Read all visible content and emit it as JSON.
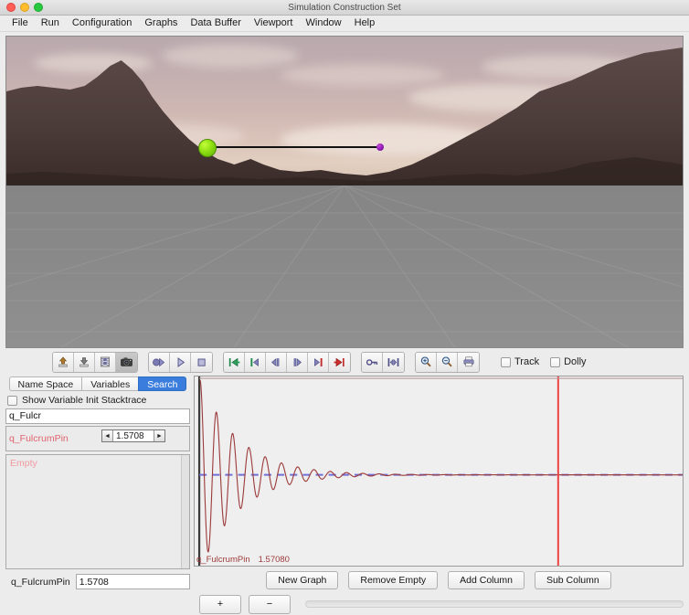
{
  "window": {
    "title": "Simulation Construction Set",
    "traffic_lights": [
      "close-button",
      "minimize-button",
      "maximize-button"
    ]
  },
  "menubar": {
    "items": [
      {
        "label": "File"
      },
      {
        "label": "Run"
      },
      {
        "label": "Configuration"
      },
      {
        "label": "Graphs"
      },
      {
        "label": "Data Buffer"
      },
      {
        "label": "Viewport"
      },
      {
        "label": "Window"
      },
      {
        "label": "Help"
      }
    ]
  },
  "viewport": {
    "scene": "pendulum-on-mountain-skybox",
    "pivot_color": "#8ede12",
    "bob_color": "#8b18b0",
    "rod_color": "#121212",
    "ground_color": "#8a8a8a"
  },
  "toolbar": {
    "groups": [
      {
        "name": "file-group",
        "buttons": [
          {
            "icon": "export-up-icon",
            "label": "Export"
          },
          {
            "icon": "import-down-icon",
            "label": "Import"
          },
          {
            "icon": "media-film-icon",
            "label": "Movie"
          },
          {
            "icon": "camera-icon",
            "label": "Snapshot",
            "pressed": true
          }
        ]
      },
      {
        "name": "sim-group",
        "buttons": [
          {
            "icon": "simulate-icon",
            "label": "Simulate"
          },
          {
            "icon": "play-icon",
            "label": "Play"
          },
          {
            "icon": "stop-icon",
            "label": "Stop"
          }
        ]
      },
      {
        "name": "transport-group",
        "buttons": [
          {
            "icon": "goto-in-point-icon",
            "label": "Goto In Point"
          },
          {
            "icon": "set-in-point-icon",
            "label": "Set In Point"
          },
          {
            "icon": "step-back-icon",
            "label": "Step Backward"
          },
          {
            "icon": "step-forward-icon",
            "label": "Step Forward"
          },
          {
            "icon": "set-out-point-icon",
            "label": "Set Out Point"
          },
          {
            "icon": "goto-out-point-icon",
            "label": "Goto Out Point"
          }
        ]
      },
      {
        "name": "data-group",
        "buttons": [
          {
            "icon": "key-icon",
            "label": "Add Key Point"
          },
          {
            "icon": "crop-data-icon",
            "label": "Crop Buffer"
          }
        ]
      },
      {
        "name": "zoom-group",
        "buttons": [
          {
            "icon": "zoom-in-icon",
            "label": "Zoom In"
          },
          {
            "icon": "zoom-out-icon",
            "label": "Zoom Out"
          },
          {
            "icon": "print-icon",
            "label": "Print"
          }
        ]
      }
    ],
    "checkboxes": [
      {
        "label": "Track",
        "checked": false
      },
      {
        "label": "Dolly",
        "checked": false
      }
    ]
  },
  "left_panel": {
    "tabs": [
      {
        "label": "Name Space",
        "active": false
      },
      {
        "label": "Variables",
        "active": false
      },
      {
        "label": "Search",
        "active": true
      }
    ],
    "stacktrace_checkbox": {
      "label": "Show Variable Init Stacktrace",
      "checked": false
    },
    "search_input": {
      "value": "q_Fulcr",
      "placeholder": ""
    },
    "result": {
      "name": "q_FulcrumPin",
      "value": "1.5708",
      "decrement_label": "◄",
      "increment_label": "►"
    },
    "entry_list": {
      "empty_text": "Empty"
    },
    "value_row": {
      "label": "q_FulcrumPin",
      "value": "1.5708"
    }
  },
  "graph_panel": {
    "legend": [
      {
        "name": "q_FulcrumPin",
        "value": "1.57080",
        "color": "#9c3b3b"
      }
    ],
    "buttons": [
      {
        "label": "New Graph"
      },
      {
        "label": "Remove Empty"
      },
      {
        "label": "Add Column"
      },
      {
        "label": "Sub Column"
      }
    ],
    "zoom_buttons": [
      {
        "label": "+"
      },
      {
        "label": "−"
      }
    ]
  },
  "chart_data": {
    "type": "line",
    "title": "q_FulcrumPin",
    "xlabel": "",
    "ylabel": "",
    "series": [
      {
        "name": "q_FulcrumPin",
        "color": "#9c3b3b",
        "description": "damped sinusoid, exponentially decaying oscillation",
        "amplitude_initial": 1.0,
        "decay_constant": 0.45,
        "frequency_cycles": 22,
        "final_value": 1.5708
      }
    ],
    "baseline": {
      "value": 0,
      "color": "#6f6fd8",
      "style": "dashed"
    },
    "cursor": {
      "x_fraction": 0.745,
      "color": "#ef4444"
    },
    "grid": false,
    "legend_position": "bottom-left",
    "current_readout": "1.57080"
  }
}
